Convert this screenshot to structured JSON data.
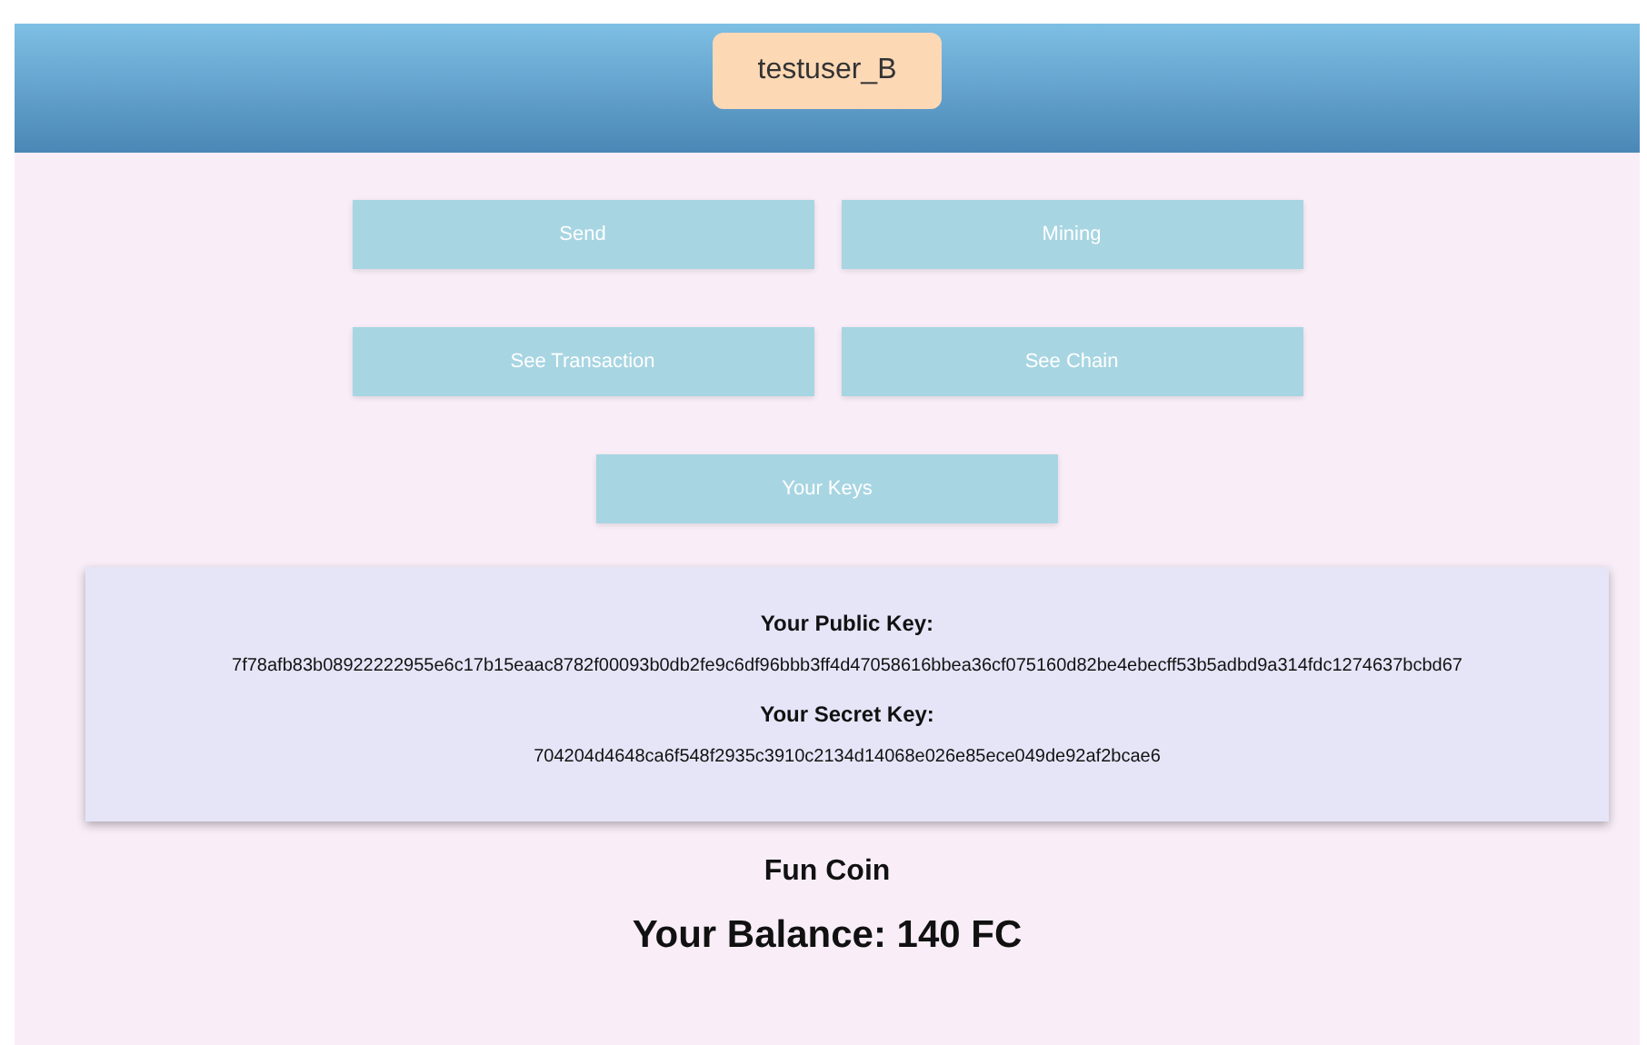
{
  "header": {
    "username": "testuser_B"
  },
  "buttons": [
    [
      "Send",
      "Mining"
    ],
    [
      "See Transaction",
      "See Chain"
    ],
    [
      "Your Keys"
    ]
  ],
  "keys": {
    "public_label": "Your Public Key:",
    "public_key": "7f78afb83b08922222955e6c17b15eaac8782f00093b0db2fe9c6df96bbb3ff4d47058616bbea36cf075160d82be4ebecff53b5adbd9a314fdc1274637bcbd67",
    "secret_label": "Your Secret Key:",
    "secret_key": "704204d4648ca6f548f2935c3910c2134d14068e026e85ece049de92af2bcae6"
  },
  "coin_name": "Fun Coin",
  "balance": "Your Balance: 140 FC"
}
